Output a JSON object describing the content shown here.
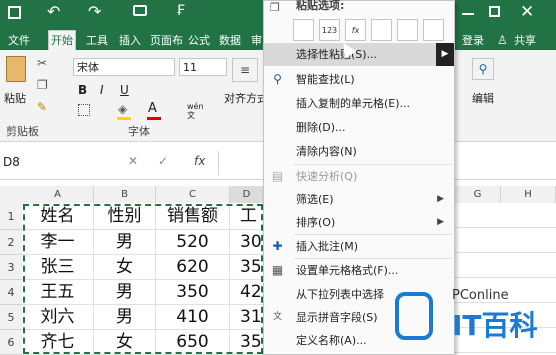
{
  "titlebar": {
    "icons": [
      "save-icon",
      "undo-icon",
      "redo-icon",
      "camera-icon",
      "custom-quick-access-icon"
    ]
  },
  "tabs": [
    "文件",
    "开始",
    "工具",
    "插入",
    "页面布",
    "公式",
    "数据",
    "审"
  ],
  "active_tab": "开始",
  "right_tabs": {
    "login": "登录",
    "share": "共享"
  },
  "ribbon": {
    "paste": "粘贴",
    "clipboard_group": "剪贴板",
    "font_name": "宋体",
    "font_size": "11",
    "font_group": "字体",
    "align_group_partial": "对齐方式",
    "edit_label": "编辑",
    "bold": "B",
    "italic": "I",
    "underline": "U",
    "font_color": "A",
    "wen": "wén 文"
  },
  "formula_bar": {
    "name_box": "D8",
    "fx": "fx"
  },
  "columns": [
    "A",
    "B",
    "C",
    "D",
    "G",
    "H"
  ],
  "rows": [
    "1",
    "2",
    "3",
    "4",
    "5",
    "6"
  ],
  "table": [
    [
      "姓名",
      "性别",
      "销售额",
      "工"
    ],
    [
      "李一",
      "男",
      "520",
      "30"
    ],
    [
      "张三",
      "女",
      "620",
      "35"
    ],
    [
      "王五",
      "男",
      "350",
      "42"
    ],
    [
      "刘六",
      "男",
      "410",
      "31"
    ],
    [
      "齐七",
      "女",
      "650",
      "35"
    ]
  ],
  "context_menu": {
    "paste_options_label": "粘贴选项:",
    "paste_buttons": [
      "",
      "123",
      "fx",
      "",
      "",
      ""
    ],
    "items": [
      {
        "label": "选择性粘贴(S)...",
        "icon": "",
        "submenu": true,
        "highlight": true
      },
      {
        "label": "智能查找(L)",
        "icon": "smart-lookup-icon"
      },
      {
        "label": "插入复制的单元格(E)...",
        "icon": ""
      },
      {
        "label": "删除(D)...",
        "icon": ""
      },
      {
        "label": "清除内容(N)",
        "icon": ""
      },
      {
        "label": "快速分析(Q)",
        "icon": "quick-analysis-icon",
        "disabled": true
      },
      {
        "label": "筛选(E)",
        "icon": "",
        "submenu": true
      },
      {
        "label": "排序(O)",
        "icon": "",
        "submenu": true
      },
      {
        "label": "插入批注(M)",
        "icon": "comment-icon"
      },
      {
        "label": "设置单元格格式(F)...",
        "icon": "format-cells-icon"
      },
      {
        "label": "从下拉列表中选择",
        "icon": ""
      },
      {
        "label": "显示拼音字段(S)",
        "icon": "pinyin-icon"
      },
      {
        "label": "定义名称(A)...",
        "icon": ""
      }
    ]
  },
  "watermark": {
    "brand_small": "PConline",
    "brand_big": "IT百科"
  },
  "colors": {
    "excel_green": "#217346",
    "ribbon_bg": "#f3f3f3",
    "brand_blue": "#1a7ad4"
  }
}
